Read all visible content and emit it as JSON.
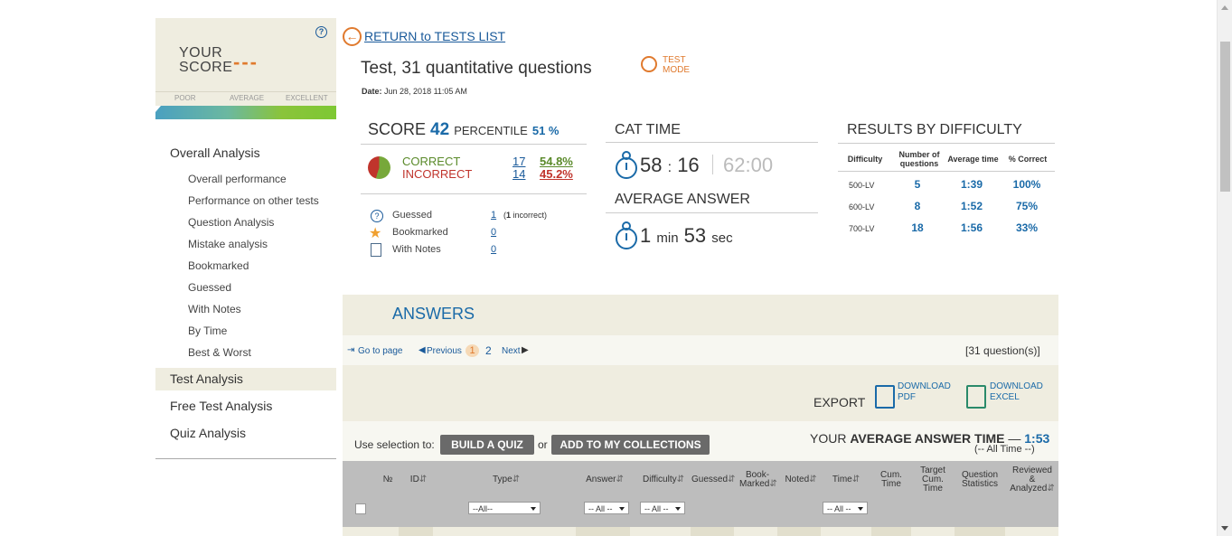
{
  "score_card": {
    "your_label_1": "YOUR",
    "your_label_2": "SCORE",
    "score_placeholder": "---",
    "help": "?",
    "scale": [
      "POOR",
      "AVERAGE",
      "EXCELLENT"
    ]
  },
  "sidebar": {
    "overall": "Overall Analysis",
    "sub_items": [
      "Overall performance",
      "Performance on other tests",
      "Question Analysis",
      "Mistake analysis",
      "Bookmarked",
      "Guessed",
      "With Notes",
      "By Time",
      "Best & Worst"
    ],
    "test_analysis": "Test Analysis",
    "free_test_analysis": "Free Test Analysis",
    "quiz_analysis": "Quiz Analysis"
  },
  "header": {
    "return_link": "RETURN to TESTS LIST",
    "title": "Test, 31 quantitative questions",
    "date_label": "Date:",
    "date_value": "Jun 28, 2018 11:05 AM",
    "mode_1": "TEST",
    "mode_2": "MODE"
  },
  "score": {
    "score_label": "SCORE",
    "score_value": "42",
    "percentile_label": "PERCENTILE",
    "percentile_value": "51 %",
    "correct_label": "CORRECT",
    "incorrect_label": "INCORRECT",
    "correct_count": "17",
    "incorrect_count": "14",
    "correct_pct": "54.8%",
    "incorrect_pct": "45.2%",
    "correct_fraction": 0.548,
    "guessed_label": "Guessed",
    "guessed_value": "1",
    "guessed_note_num": "1",
    "guessed_note_text": "incorrect",
    "bookmarked_label": "Bookmarked",
    "bookmarked_value": "0",
    "notes_label": "With Notes",
    "notes_value": "0"
  },
  "cat_time": {
    "title": "CAT TIME",
    "min": "58",
    "sep": ":",
    "sec": "16",
    "limit": "62:00",
    "avg_title": "AVERAGE ANSWER",
    "avg_min": "1",
    "avg_min_unit": "min",
    "avg_sec": "53",
    "avg_sec_unit": "sec"
  },
  "difficulty": {
    "title": "RESULTS BY DIFFICULTY",
    "headers": [
      "Difficulty",
      "Number of questions",
      "Average time",
      "% Correct"
    ],
    "rows": [
      {
        "level": "500-LV",
        "count": "5",
        "time": "1:39",
        "pct": "100%"
      },
      {
        "level": "600-LV",
        "count": "8",
        "time": "1:52",
        "pct": "75%"
      },
      {
        "level": "700-LV",
        "count": "18",
        "time": "1:56",
        "pct": "33%"
      }
    ]
  },
  "answers": {
    "title": "ANSWERS",
    "go_to_page": "Go to page",
    "previous": "Previous",
    "page_current": "1",
    "page_2": "2",
    "next": "Next",
    "question_count": "[31 question(s)]",
    "export": "EXPORT",
    "download_pdf_1": "DOWNLOAD",
    "download_pdf_2": "PDF",
    "download_excel_1": "DOWNLOAD",
    "download_excel_2": "EXCEL",
    "use_selection": "Use selection to:",
    "build_quiz": "BUILD A QUIZ",
    "or": "or",
    "add_collections": "ADD TO MY COLLECTIONS",
    "your_label": "YOUR",
    "avg_answer_time_label": "AVERAGE ANSWER TIME",
    "dash": "—",
    "avg_answer_time_value": "1:53",
    "all_time": "(-- All Time --)"
  },
  "table": {
    "headers": {
      "no": "№",
      "id": "ID",
      "type": "Type",
      "answer": "Answer",
      "difficulty": "Difficulty",
      "guessed": "Guessed",
      "bookmarked_1": "Book-",
      "bookmarked_2": "Marked",
      "noted": "Noted",
      "time": "Time",
      "cum_time_1": "Cum.",
      "cum_time_2": "Time",
      "target_1": "Target",
      "target_2": "Cum.",
      "target_3": "Time",
      "qstats_1": "Question",
      "qstats_2": "Statistics",
      "reviewed_1": "Reviewed",
      "reviewed_2": "&",
      "reviewed_3": "Analyzed"
    },
    "filters": {
      "type": "--All--",
      "answer": "-- All --",
      "difficulty": "-- All --",
      "time": "-- All --"
    }
  }
}
